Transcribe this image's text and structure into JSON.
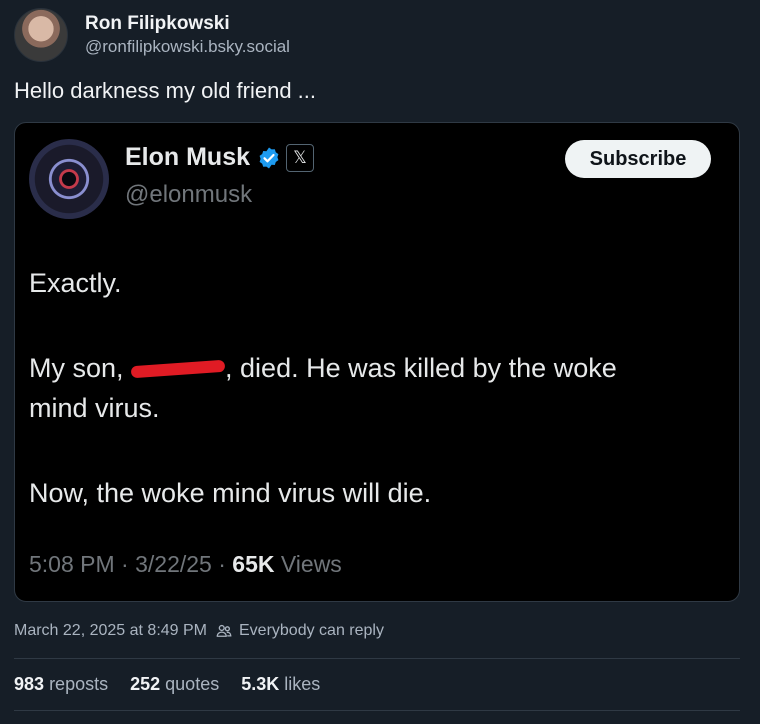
{
  "post": {
    "author_name": "Ron Filipkowski",
    "author_handle": "@ronfilipkowski.bsky.social",
    "text": "Hello darkness my old friend ...",
    "date": "March 22, 2025 at 8:49 PM",
    "reply_setting": "Everybody can reply",
    "stats": {
      "reposts_count": "983",
      "reposts_label": "reposts",
      "quotes_count": "252",
      "quotes_label": "quotes",
      "likes_count": "5.3K",
      "likes_label": "likes"
    }
  },
  "embed": {
    "name": "Elon Musk",
    "handle": "@elonmusk",
    "subscribe_label": "Subscribe",
    "x_badge": "𝕏",
    "lines": {
      "l1": "Exactly.",
      "l2a": "My son, ",
      "l2b": ", died. He was killed by the woke",
      "l3": "mind virus.",
      "l4": "Now, the woke mind virus will die."
    },
    "meta": {
      "time_date": "5:08 PM · 3/22/25 · ",
      "views_count": "65K",
      "views_label": " Views"
    }
  },
  "colors": {
    "background": "#161e27",
    "embed_background": "#000000",
    "verified": "#1d9bf0",
    "redaction": "#e01b24"
  }
}
